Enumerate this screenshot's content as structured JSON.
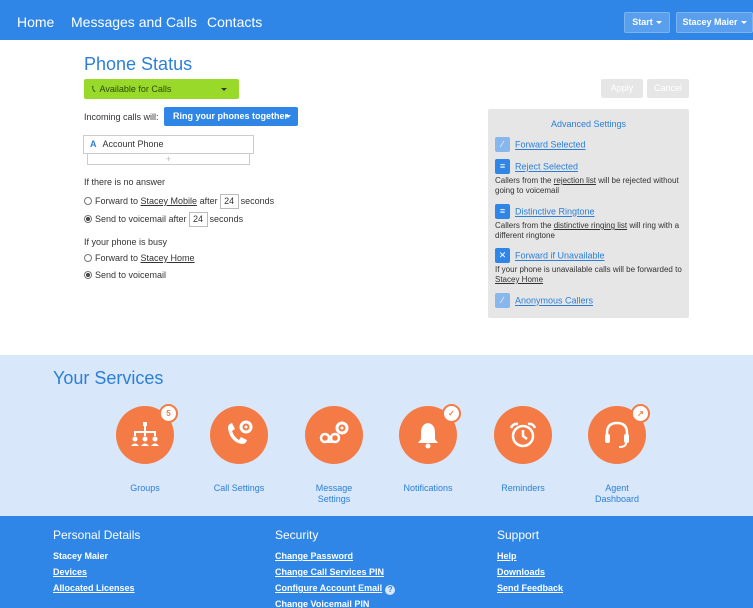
{
  "nav": {
    "home": "Home",
    "messages": "Messages and Calls",
    "contacts": "Contacts",
    "start": "Start",
    "user": "Stacey Maier"
  },
  "phone_status": {
    "title": "Phone Status",
    "availability": "Available for Calls",
    "incoming_label": "Incoming calls will:",
    "ring_option": "Ring your phones together",
    "account_badge": "A",
    "account_phone": "Account Phone",
    "add_symbol": "+",
    "no_answer_heading": "If there is no answer",
    "forward_to": "Forward to",
    "forward_target": "Stacey Mobile",
    "after": "after",
    "seconds": "seconds",
    "forward_seconds": "24",
    "voicemail_after": "Send to voicemail after",
    "voicemail_seconds": "24",
    "busy_heading": "If your phone is busy",
    "busy_forward_target": "Stacey Home",
    "busy_voicemail": "Send to voicemail",
    "apply": "Apply",
    "cancel": "Cancel"
  },
  "advanced": {
    "title": "Advanced Settings",
    "forward_selected": "Forward Selected",
    "reject_selected": "Reject Selected",
    "reject_desc_1": "Callers from the",
    "reject_desc_link": "rejection list",
    "reject_desc_2": "will be rejected without going to voicemail",
    "distinctive": "Distinctive Ringtone",
    "distinctive_desc_1": "Callers from the",
    "distinctive_desc_link": "distinctive ringing list",
    "distinctive_desc_2": "will ring with a different ringtone",
    "forward_unavailable": "Forward if Unavailable",
    "unavailable_desc_1": "If your phone is unavailable calls will be forwarded to",
    "unavailable_desc_link": "Stacey Home",
    "anonymous": "Anonymous Callers"
  },
  "services": {
    "title": "Your Services",
    "groups": "Groups",
    "groups_badge": "5",
    "call_settings": "Call Settings",
    "message_settings_1": "Message",
    "message_settings_2": "Settings",
    "notifications": "Notifications",
    "reminders": "Reminders",
    "agent_1": "Agent",
    "agent_2": "Dashboard"
  },
  "footer": {
    "personal": "Personal Details",
    "user_name": "Stacey Maier",
    "devices": "Devices",
    "licenses": "Allocated Licenses",
    "security": "Security",
    "change_password": "Change Password",
    "change_pin": "Change Call Services PIN",
    "configure_email": "Configure Account Email",
    "change_vm_pin": "Change Voicemail PIN",
    "support": "Support",
    "help": "Help",
    "downloads": "Downloads",
    "feedback": "Send Feedback"
  },
  "colors": {
    "brand_blue": "#2f86e6",
    "accent_orange": "#f47b45",
    "available_green": "#99d92a"
  }
}
